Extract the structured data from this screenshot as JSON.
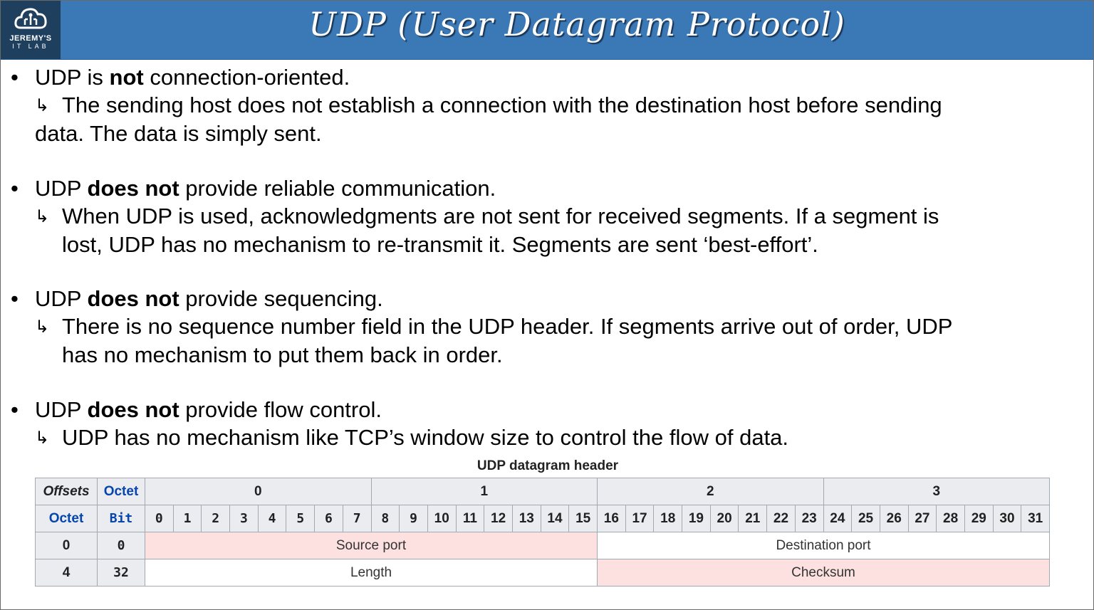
{
  "header": {
    "logo_line1": "JEREMY'S",
    "logo_line2": "IT LAB",
    "title": "UDP (User Datagram Protocol)"
  },
  "bullets": [
    {
      "pre": "UDP is ",
      "bold": "not",
      "post": " connection-oriented.",
      "sub_line1": "The sending host does not establish a connection with the destination host before sending",
      "sub_line2": "data.  The data is simply sent."
    },
    {
      "pre": "UDP ",
      "bold": "does not",
      "post": " provide reliable communication.",
      "sub_line1": "When UDP is used, acknowledgments are not sent for received segments.  If a segment is",
      "sub_line2": "lost, UDP has no mechanism to re-transmit it.  Segments are sent ‘best-effort’."
    },
    {
      "pre": "UDP ",
      "bold": "does not",
      "post": " provide sequencing.",
      "sub_line1": "There is no sequence number field in the UDP header.  If segments arrive out of order, UDP",
      "sub_line2": "has no mechanism to put them back in order."
    },
    {
      "pre": "UDP ",
      "bold": "does not",
      "post": " provide flow control.",
      "sub_line1": "UDP has no mechanism like TCP’s window size to control the flow of data."
    }
  ],
  "bullet_glyph": "•",
  "arrow_glyph": "↳",
  "table": {
    "caption": "UDP datagram header",
    "offsets_label": "Offsets",
    "octet_label": "Octet",
    "bit_label": "Bit",
    "octet_numbers": [
      "0",
      "1",
      "2",
      "3"
    ],
    "bit_numbers": [
      "0",
      "1",
      "2",
      "3",
      "4",
      "5",
      "6",
      "7",
      "8",
      "9",
      "10",
      "11",
      "12",
      "13",
      "14",
      "15",
      "16",
      "17",
      "18",
      "19",
      "20",
      "21",
      "22",
      "23",
      "24",
      "25",
      "26",
      "27",
      "28",
      "29",
      "30",
      "31"
    ],
    "rows": [
      {
        "octet": "0",
        "bit": "0",
        "left": "Source port",
        "right": "Destination port"
      },
      {
        "octet": "4",
        "bit": "32",
        "left": "Length",
        "right": "Checksum"
      }
    ],
    "colors": {
      "header_bg": "#eaecf0",
      "pink": "#fde1e1",
      "link_blue": "#0645ad"
    }
  }
}
